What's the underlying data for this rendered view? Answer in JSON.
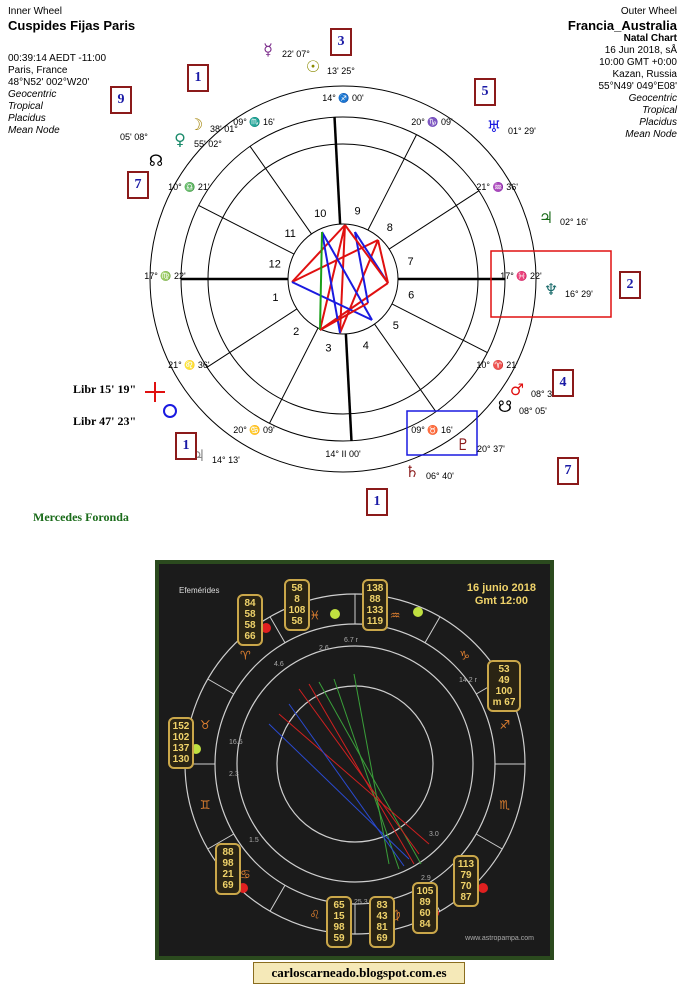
{
  "inner_wheel": {
    "heading": "Inner Wheel",
    "title": "Cuspides Fijas Paris",
    "time": "00:39:14  AEDT -11:00",
    "place": "Paris, France",
    "coords": "48°N52' 002°W20'",
    "system": [
      "Geocentric",
      "Tropical",
      "Placidus",
      "Mean Node"
    ]
  },
  "outer_wheel": {
    "heading": "Outer Wheel",
    "title": "Francia_Australia",
    "subtitle": "Natal Chart",
    "date": "16 Jun 2018, sÅ",
    "time": "10:00  GMT +0:00",
    "place": "Kazan, Russia",
    "coords": "55°N49' 049°E08'",
    "system": [
      "Geocentric",
      "Tropical",
      "Placidus",
      "Mean Node"
    ]
  },
  "cusps": [
    {
      "deg": "14°",
      "min": "00'",
      "sign": "II"
    },
    {
      "deg": "09°",
      "min": "16'",
      "sign": "♉"
    },
    {
      "deg": "10°",
      "min": "21'",
      "sign": "♈"
    },
    {
      "deg": "17°",
      "min": "22'",
      "sign": "♓"
    },
    {
      "deg": "21°",
      "min": "36'",
      "sign": "♒"
    },
    {
      "deg": "20°",
      "min": "09'",
      "sign": "♑"
    },
    {
      "deg": "14°",
      "min": "00'",
      "sign": "♐"
    },
    {
      "deg": "09°",
      "min": "16'",
      "sign": "♏"
    },
    {
      "deg": "10°",
      "min": "21'",
      "sign": "♎"
    },
    {
      "deg": "17°",
      "min": "22'",
      "sign": "♍"
    },
    {
      "deg": "21°",
      "min": "36'",
      "sign": "♌"
    },
    {
      "deg": "20°",
      "min": "09'",
      "sign": "♋"
    }
  ],
  "houses": [
    "1",
    "2",
    "3",
    "4",
    "5",
    "6",
    "7",
    "8",
    "9",
    "10",
    "11",
    "12"
  ],
  "markers": [
    "1",
    "3",
    "5",
    "2",
    "4",
    "7",
    "1",
    "1",
    "7",
    "9"
  ],
  "planet_labels": {
    "sun": "13'  25°",
    "mercury": "22'  07°",
    "moon": "38'  01°",
    "venus": "55'  02°",
    "node": "05'  08°",
    "uranus": "01°  29'",
    "jupiter": "02°  16'",
    "neptune": "16°  29'",
    "mars": "08°  33'",
    "south_node": "08°  05'",
    "pluto": "20°  37'",
    "saturn": "06°  40'",
    "jupiter2": "14°  13'"
  },
  "libr": [
    "Libr  15' 19\"",
    "Libr  47' 23\""
  ],
  "author": "Mercedes Foronda",
  "ephemeris": {
    "label": "Efemérides",
    "date": "16 junio 2018",
    "gmt": "Gmt 12:00",
    "site": "www.astropampa.com",
    "boxes": [
      [
        "84",
        "58",
        "58",
        "66"
      ],
      [
        "58",
        "8",
        "108",
        "58"
      ],
      [
        "138",
        "88",
        "133",
        "119"
      ],
      [
        "53",
        "49",
        "100",
        "m 67"
      ],
      [
        "152",
        "102",
        "137",
        "130"
      ],
      [
        "88",
        "98",
        "21",
        "69"
      ],
      [
        "113",
        "79",
        "70",
        "87"
      ],
      [
        "105",
        "89",
        "60",
        "84"
      ],
      [
        "65",
        "15",
        "98",
        "59"
      ],
      [
        "83",
        "43",
        "81",
        "69"
      ]
    ],
    "small_vals": [
      "2.6",
      "6.7 r",
      "4.6",
      "14.2 r",
      "16.5",
      "2.3",
      "1.5",
      "3.0",
      "2.9",
      "25.3",
      "7.5"
    ]
  },
  "blog": "carloscarneado.blogspot.com.es",
  "colors": {
    "red": "#e01010",
    "blue": "#1a1ae0",
    "green": "#1aa01a",
    "box": "#8b1a1a",
    "gold": "#caa74a"
  }
}
